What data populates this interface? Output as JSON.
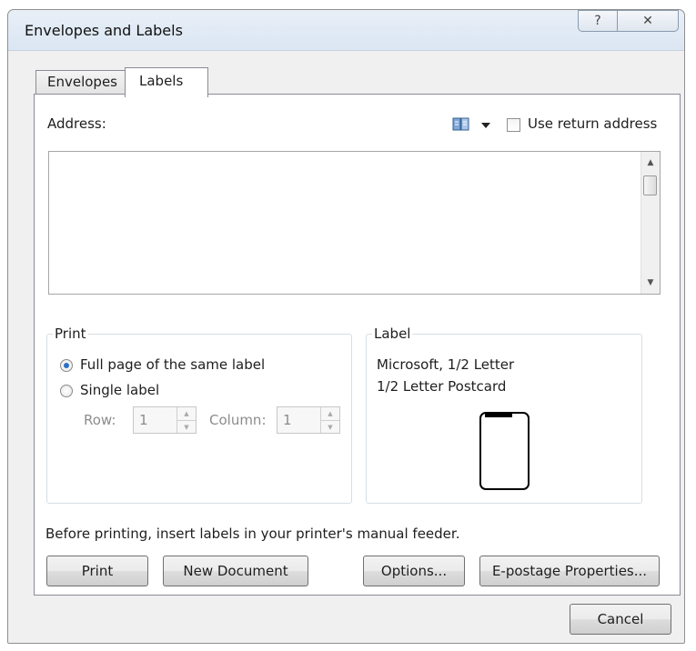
{
  "window": {
    "title": "Envelopes and Labels",
    "help_glyph": "?",
    "close_glyph": "✕"
  },
  "tabs": {
    "envelopes": "Envelopes",
    "labels": "Labels",
    "active": "Labels"
  },
  "address": {
    "label": "Address:",
    "value": "",
    "book_icon": "address-book-icon",
    "use_return_address_label": "Use return address",
    "use_return_address_checked": false
  },
  "print_group": {
    "title": "Print",
    "full_page_label": "Full page of the same label",
    "full_page_selected": true,
    "single_label_label": "Single label",
    "single_label_selected": false,
    "row_label": "Row:",
    "row_value": "1",
    "column_label": "Column:",
    "column_value": "1"
  },
  "label_group": {
    "title": "Label",
    "line1": "Microsoft, 1/2 Letter",
    "line2": "1/2 Letter Postcard"
  },
  "notice": "Before printing, insert labels in your printer's manual feeder.",
  "buttons": {
    "print": "Print",
    "new_document": "New Document",
    "options": "Options...",
    "epostage": "E-postage Properties...",
    "cancel": "Cancel"
  },
  "colors": {
    "radio_selected": "#2b6fc5",
    "title_bar": "#dbe6f3"
  }
}
